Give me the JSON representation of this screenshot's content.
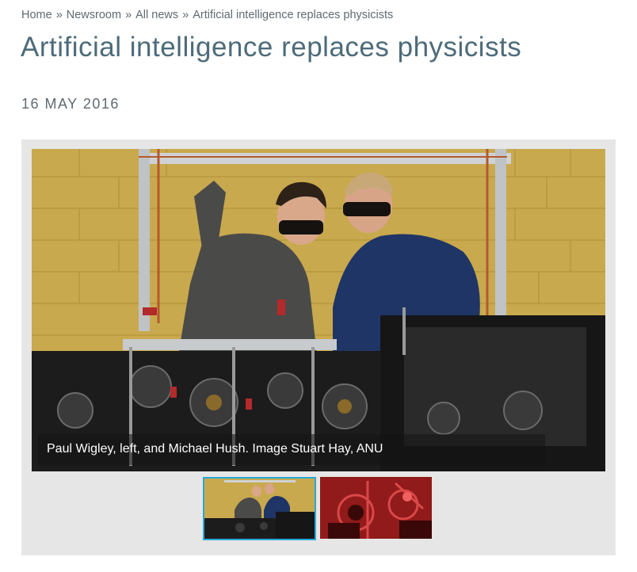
{
  "breadcrumb": {
    "items": [
      "Home",
      "Newsroom",
      "All news",
      "Artificial intelligence replaces physicists"
    ],
    "separator": "»"
  },
  "article": {
    "title": "Artificial intelligence replaces physicists",
    "date": "16 MAY 2016"
  },
  "gallery": {
    "caption": "Paul Wigley, left, and Michael Hush. Image Stuart Hay, ANU",
    "active_thumb_border": "#2aa9d6",
    "thumbnails": [
      {
        "label": "thumbnail-lab-photo",
        "selected": true
      },
      {
        "label": "thumbnail-red-lab-photo",
        "selected": false
      }
    ]
  },
  "colors": {
    "title": "#4d6b7a",
    "breadcrumb": "#5f6a70",
    "gallery_bg": "#e6e6e6"
  }
}
